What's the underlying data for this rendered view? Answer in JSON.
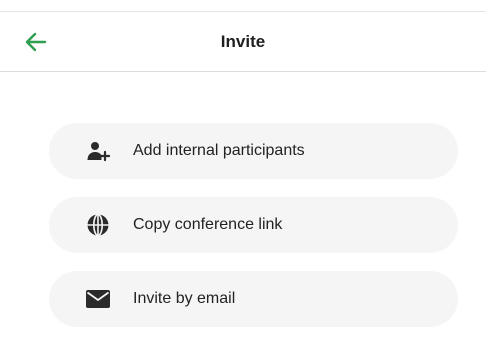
{
  "header": {
    "title": "Invite",
    "back_icon": "arrow-left-icon",
    "accent_color": "#2e9e4f"
  },
  "options": [
    {
      "label": "Add internal participants",
      "icon": "add-user-icon"
    },
    {
      "label": "Copy conference link",
      "icon": "globe-icon"
    },
    {
      "label": "Invite by email",
      "icon": "envelope-icon"
    }
  ]
}
